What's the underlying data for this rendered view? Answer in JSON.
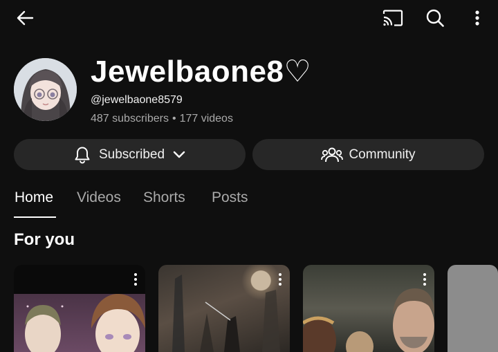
{
  "topbar": {
    "back_icon": "back-arrow-icon",
    "cast_icon": "cast-icon",
    "search_icon": "search-icon",
    "more_icon": "more-vertical-icon"
  },
  "channel": {
    "name": "Jewelbaone8♡",
    "handle": "@jewelbaone8579",
    "subscribers": "487 subscribers",
    "separator": "•",
    "videos": "177 videos"
  },
  "actions": {
    "subscribed_label": "Subscribed",
    "community_label": "Community"
  },
  "tabs": [
    {
      "label": "Home",
      "active": true
    },
    {
      "label": "Videos",
      "active": false
    },
    {
      "label": "Shorts",
      "active": false
    },
    {
      "label": "Posts",
      "active": false
    }
  ],
  "section": {
    "title": "For you"
  },
  "colors": {
    "background": "#0f0f0f",
    "pill": "#272727",
    "secondary_text": "#aaaaaa"
  }
}
